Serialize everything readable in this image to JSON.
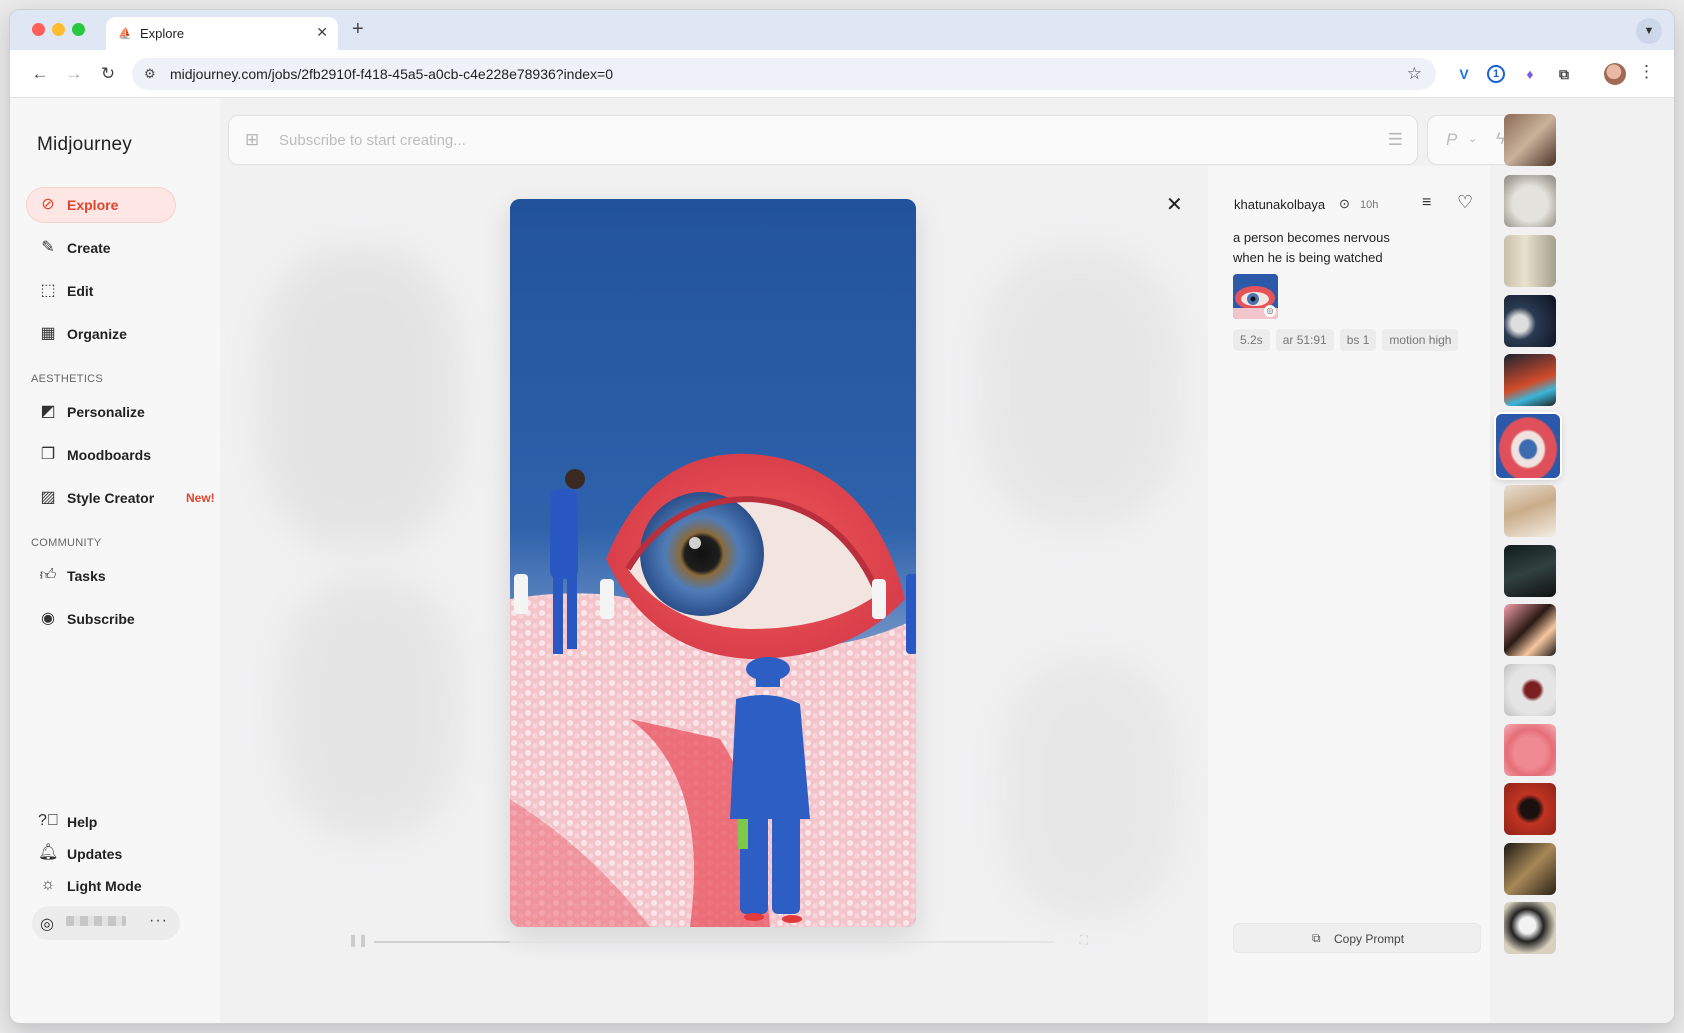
{
  "browser": {
    "tab_title": "Explore",
    "url": "midjourney.com/jobs/2fb2910f-f418-45a5-a0cb-c4e228e78936?index=0"
  },
  "sidebar": {
    "brand": "Midjourney",
    "nav": [
      {
        "label": "Explore",
        "icon": "compass-icon"
      },
      {
        "label": "Create",
        "icon": "brush-icon"
      },
      {
        "label": "Edit",
        "icon": "edit-canvas-icon"
      },
      {
        "label": "Organize",
        "icon": "grid-icon"
      }
    ],
    "aesthetics_label": "AESTHETICS",
    "aesthetics": [
      {
        "label": "Personalize",
        "icon": "personalize-icon"
      },
      {
        "label": "Moodboards",
        "icon": "moodboard-icon"
      },
      {
        "label": "Style Creator",
        "icon": "style-creator-icon",
        "badge": "New!"
      }
    ],
    "community_label": "COMMUNITY",
    "community": [
      {
        "label": "Tasks",
        "icon": "thumbs-up-icon"
      },
      {
        "label": "Subscribe",
        "icon": "user-circle-icon"
      }
    ],
    "bottom": [
      {
        "label": "Help",
        "icon": "help-icon"
      },
      {
        "label": "Updates",
        "icon": "bell-icon"
      },
      {
        "label": "Light Mode",
        "icon": "sun-icon"
      }
    ]
  },
  "prompt_bar": {
    "placeholder": "Subscribe to start creating...",
    "mode_label": "P"
  },
  "details": {
    "author": "khatunakolbaya",
    "time": "10h",
    "prompt": "a person becomes nervous when he is being watched",
    "params": [
      "5.2s",
      "ar 51:91",
      "bs 1",
      "motion high"
    ],
    "copy_prompt": "Copy Prompt"
  },
  "colors": {
    "accent": "#e2452f",
    "active_bg": "#fde6e3",
    "sky_blue": "#23519c"
  },
  "video": {
    "progress": 0.2
  }
}
